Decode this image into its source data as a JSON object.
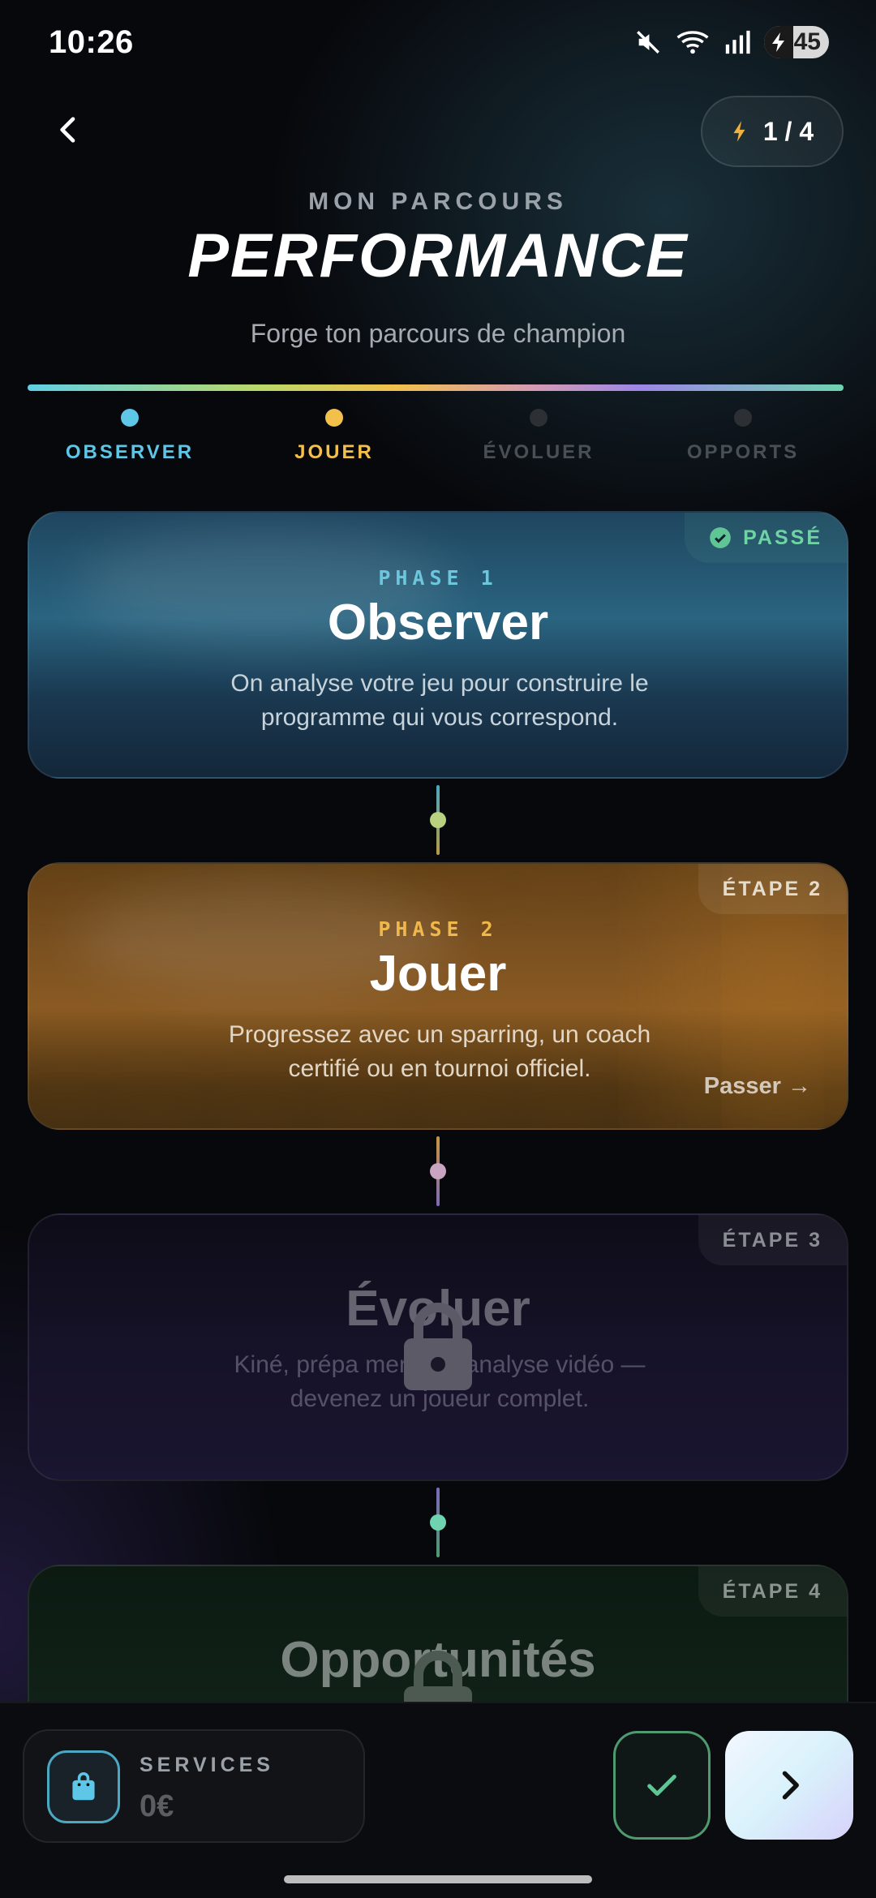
{
  "status_bar": {
    "time": "10:26",
    "battery": "45"
  },
  "header": {
    "step_counter": "1 / 4",
    "eyebrow": "MON PARCOURS",
    "title": "PERFORMANCE",
    "subtitle": "Forge ton parcours de champion"
  },
  "steps": [
    {
      "label": "OBSERVER",
      "color": "#5ec7e8",
      "state": "done"
    },
    {
      "label": "JOUER",
      "color": "#f2c04b",
      "state": "current"
    },
    {
      "label": "ÉVOLUER",
      "color": "#2c3035",
      "state": "locked"
    },
    {
      "label": "OPPORTS",
      "color": "#2c3035",
      "state": "locked"
    }
  ],
  "cards": [
    {
      "badge": "PASSÉ",
      "phase": "PHASE 1",
      "title": "Observer",
      "description": "On analyse votre jeu pour construire le programme qui vous correspond.",
      "accent": "#6cc6dc"
    },
    {
      "badge": "ÉTAPE 2",
      "phase": "PHASE 2",
      "title": "Jouer",
      "description": "Progressez avec un sparring, un coach certifié ou en tournoi officiel.",
      "skip_label": "Passer →",
      "accent": "#f0b84a"
    },
    {
      "badge": "ÉTAPE 3",
      "title": "Évoluer",
      "description": "Kiné, prépa mentale, analyse vidéo — devenez un joueur complet."
    },
    {
      "badge": "ÉTAPE 4",
      "title": "Opportunités"
    }
  ],
  "bottom_bar": {
    "services_label": "SERVICES",
    "services_value": "0€"
  },
  "icons": {
    "back": "chevron-left-icon",
    "step": "bolt-icon",
    "passed": "check-circle-icon",
    "lock": "lock-icon",
    "services": "shopping-bag-icon",
    "confirm": "check-icon",
    "next": "chevron-right-icon"
  }
}
